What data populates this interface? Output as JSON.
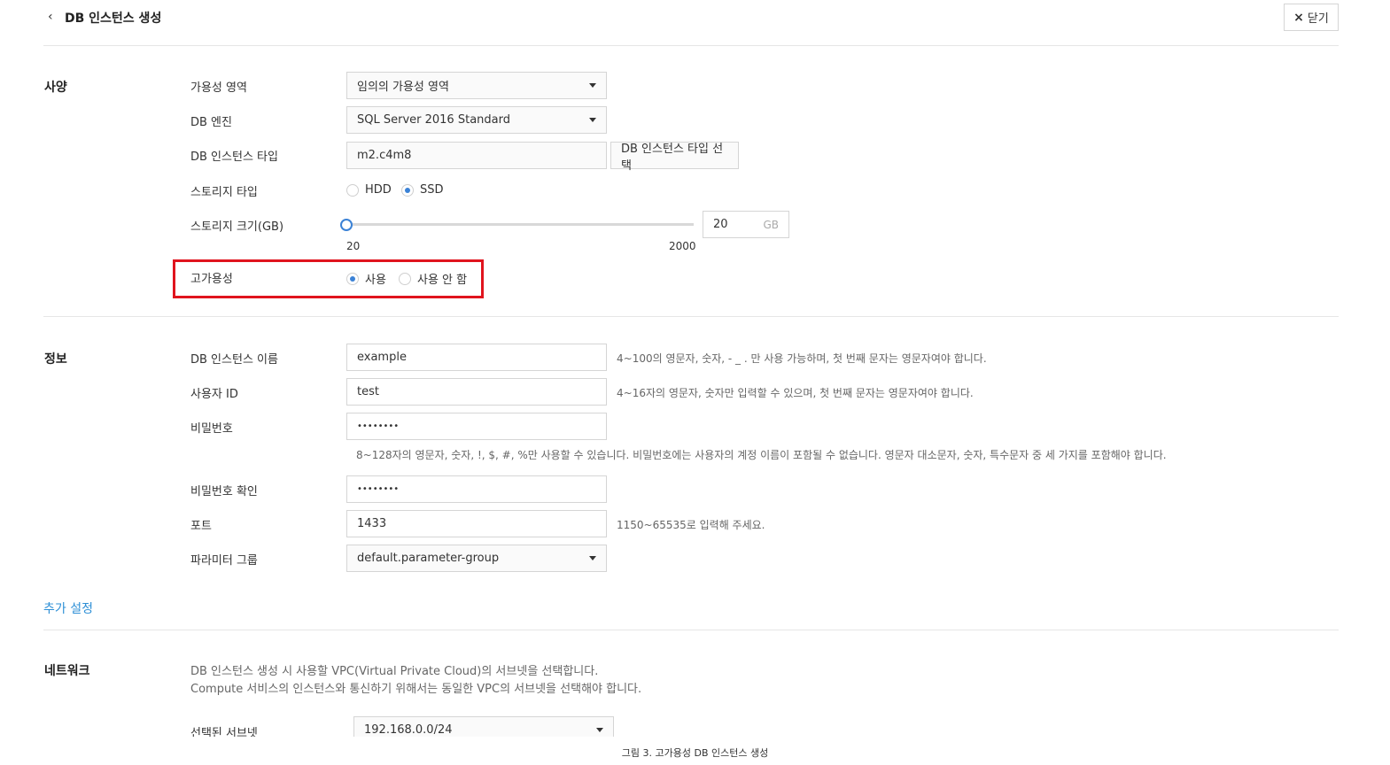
{
  "header": {
    "back_icon": "chevron-left-icon",
    "title": "DB 인스턴스 생성",
    "close_label": "닫기",
    "close_icon": "×"
  },
  "spec": {
    "section_title": "사양",
    "availability_zone": {
      "label": "가용성 영역",
      "value": "임의의 가용성 영역"
    },
    "db_engine": {
      "label": "DB 엔진",
      "value": "SQL Server 2016 Standard"
    },
    "instance_type": {
      "label": "DB 인스턴스 타입",
      "value": "m2.c4m8",
      "button": "DB 인스턴스 타입 선택"
    },
    "storage_type": {
      "label": "스토리지 타입",
      "options": [
        "HDD",
        "SSD"
      ],
      "selected": "SSD"
    },
    "storage_size": {
      "label": "스토리지 크기(GB)",
      "min": "20",
      "max": "2000",
      "value": "20",
      "unit": "GB"
    },
    "high_availability": {
      "label": "고가용성",
      "options": [
        "사용",
        "사용 안 함"
      ],
      "selected": "사용"
    }
  },
  "info": {
    "section_title": "정보",
    "instance_name": {
      "label": "DB 인스턴스 이름",
      "value": "example",
      "hint": "4~100의 영문자, 숫자, - _ . 만 사용 가능하며, 첫 번째 문자는 영문자여야 합니다."
    },
    "user_id": {
      "label": "사용자 ID",
      "value": "test",
      "hint": "4~16자의 영문자, 숫자만 입력할 수 있으며, 첫 번째 문자는 영문자여야 합니다."
    },
    "password": {
      "label": "비밀번호",
      "value": "••••••••",
      "hint": "8~128자의 영문자, 숫자, !, $, #, %만 사용할 수 있습니다. 비밀번호에는 사용자의 계정 이름이 포함될 수 없습니다. 영문자 대소문자, 숫자, 특수문자 중 세 가지를 포함해야 합니다."
    },
    "password_confirm": {
      "label": "비밀번호 확인",
      "value": "••••••••"
    },
    "port": {
      "label": "포트",
      "value": "1433",
      "hint": "1150~65535로 입력해 주세요."
    },
    "parameter_group": {
      "label": "파라미터 그룹",
      "value": "default.parameter-group"
    }
  },
  "additional_settings_link": "추가 설정",
  "network": {
    "section_title": "네트워크",
    "desc_line1": "DB 인스턴스 생성 시 사용할 VPC(Virtual Private Cloud)의 서브넷을 선택합니다.",
    "desc_line2": "Compute 서비스의 인스턴스와 통신하기 위해서는 동일한 VPC의 서브넷을 선택해야 합니다.",
    "subnet": {
      "label": "선택된 서브넷",
      "value": "192.168.0.0/24"
    }
  },
  "caption": "그림 3. 고가용성 DB 인스턴스 생성",
  "colors": {
    "accent": "#3b82d6",
    "highlight": "#e0141e",
    "link": "#2d8fd6"
  }
}
